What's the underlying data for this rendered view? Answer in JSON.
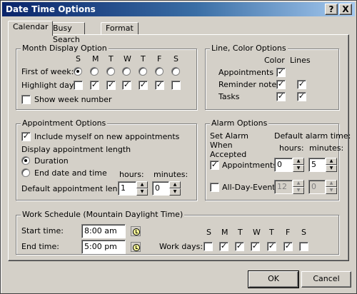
{
  "window": {
    "title": "Date Time Options",
    "help_glyph": "?",
    "close_glyph": "X"
  },
  "tabs": [
    "Calendar",
    "Busy Search",
    "Format"
  ],
  "month_display": {
    "legend": "Month Display Option",
    "day_headers": [
      "S",
      "M",
      "T",
      "W",
      "T",
      "F",
      "S"
    ],
    "first_of_week_label": "First of week:",
    "first_of_week_selected": 0,
    "highlight_label": "Highlight day:",
    "highlight_checked": [
      false,
      true,
      true,
      true,
      true,
      true,
      false
    ],
    "show_week_number_label": "Show week number",
    "show_week_number": false
  },
  "line_color": {
    "legend": "Line, Color Options",
    "col_color": "Color",
    "col_lines": "Lines",
    "rows": [
      {
        "label": "Appointments",
        "color": true,
        "lines": null
      },
      {
        "label": "Reminder notes",
        "color": true,
        "lines": true
      },
      {
        "label": "Tasks",
        "color": true,
        "lines": true
      }
    ]
  },
  "appointment": {
    "legend": "Appointment Options",
    "include_myself_label": "Include myself on new appointments",
    "include_myself": true,
    "display_length_label": "Display appointment length",
    "duration_label": "Duration",
    "end_label": "End date and time",
    "selected": "duration",
    "hours_label": "hours:",
    "minutes_label": "minutes:",
    "default_length_label": "Default appointment length:",
    "hours_value": "1",
    "minutes_value": "0"
  },
  "alarm": {
    "legend": "Alarm Options",
    "set_when_label": "Set Alarm When Accepted",
    "default_time_label": "Default alarm time:",
    "hours_label": "hours:",
    "minutes_label": "minutes:",
    "appointments_label": "Appointments",
    "appointments_checked": true,
    "appt_hours": "0",
    "appt_minutes": "5",
    "all_day_label": "All-Day-Events",
    "all_day_checked": false,
    "allday_hours": "12",
    "allday_minutes": "0"
  },
  "work_schedule": {
    "legend": "Work Schedule (Mountain Daylight Time)",
    "start_label": "Start time:",
    "start_value": "8:00 am",
    "end_label": "End time:",
    "end_value": "5:00 pm",
    "work_days_label": "Work days:",
    "day_headers": [
      "S",
      "M",
      "T",
      "W",
      "T",
      "F",
      "S"
    ],
    "days_checked": [
      false,
      true,
      true,
      true,
      true,
      true,
      false
    ]
  },
  "buttons": {
    "ok": "OK",
    "cancel": "Cancel"
  }
}
